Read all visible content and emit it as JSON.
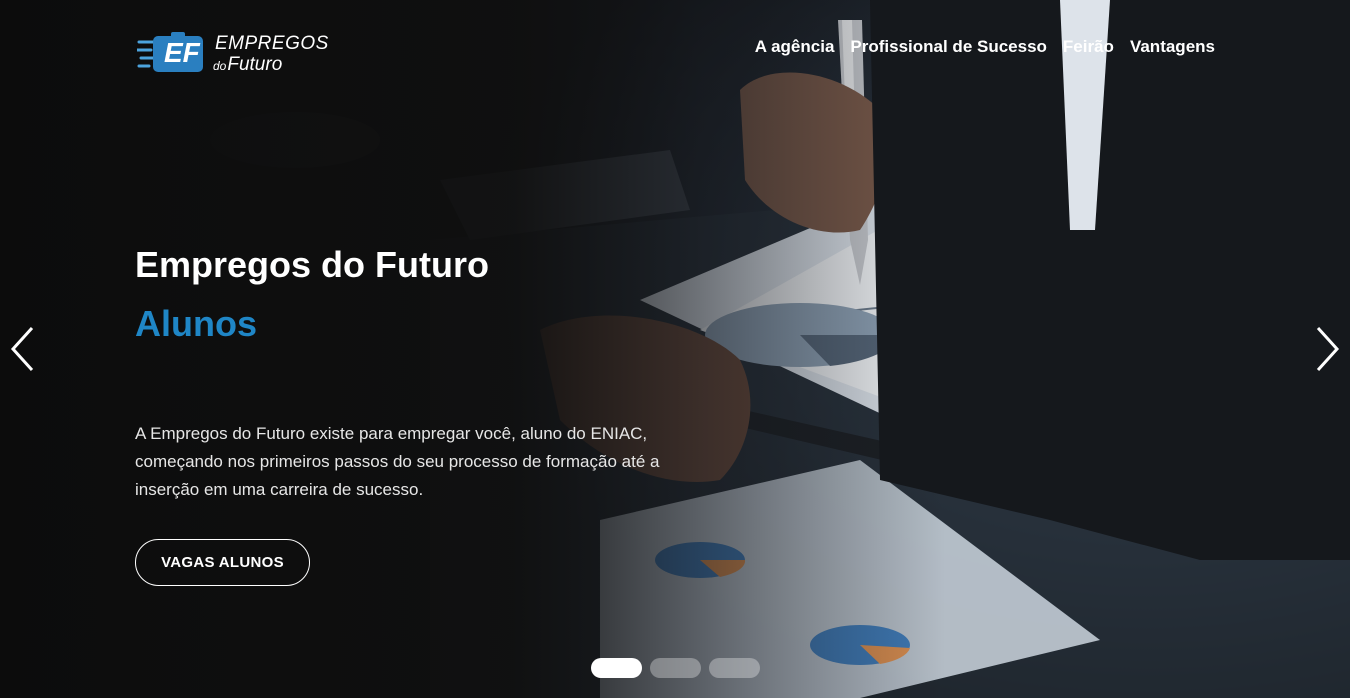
{
  "logo": {
    "mark": "EF",
    "line1": "EMPREGOS",
    "line2_small": "do",
    "line2": "Futuro"
  },
  "nav": {
    "items": [
      "A agência",
      "Profissional de Sucesso",
      "Feirão",
      "Vantagens"
    ]
  },
  "slide": {
    "title": "Empregos do Futuro",
    "subtitle": "Alunos",
    "description": "A Empregos do Futuro existe para empregar você, aluno do ENIAC, começando nos primeiros passos do seu processo de formação até a inserção em uma carreira de sucesso.",
    "cta": "VAGAS ALUNOS"
  },
  "carousel": {
    "prev_icon": "chevron-left-icon",
    "next_icon": "chevron-right-icon",
    "slide_count": 3,
    "active_index": 0
  },
  "colors": {
    "accent": "#1f86c6",
    "background": "#0d0f12"
  }
}
